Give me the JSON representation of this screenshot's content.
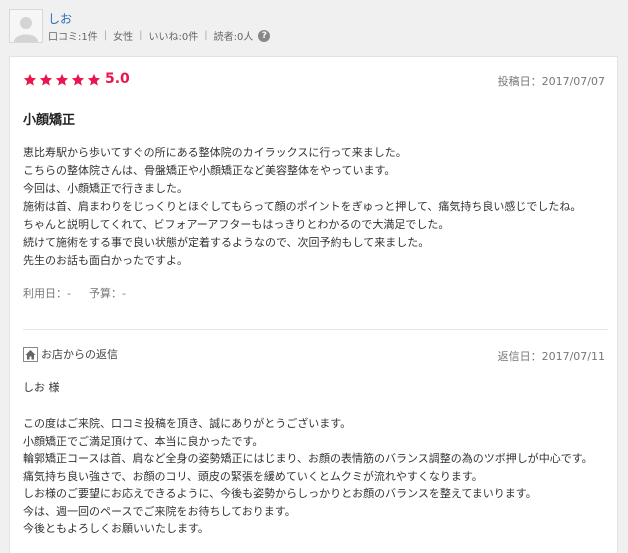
{
  "user": {
    "name": "しお",
    "stats": [
      "口コミ:1件",
      "女性",
      "いいね:0件",
      "読者:0人"
    ],
    "help": "?"
  },
  "review": {
    "rating": "5.0",
    "star_count": 5,
    "star_color": "#e8174e",
    "posted": "投稿日：2017/07/07",
    "title": "小顔矯正",
    "body": [
      "恵比寿駅から歩いてすぐの所にある整体院のカイラックスに行って来ました。",
      "こちらの整体院さんは、骨盤矯正や小顔矯正など美容整体をやっています。",
      "今回は、小顔矯正で行きました。",
      "施術は首、肩まわりをじっくりとほぐしてもらって顔のポイントをぎゅっと押して、痛気持ち良い感じでしたね。",
      "ちゃんと説明してくれて、ビフォアーアフターもはっきりとわかるので大満足でした。",
      "続けて施術をする事で良い状態が定着するようなので、次回予約もして来ました。",
      "先生のお話も面白かったですよ。"
    ],
    "usage": "利用日：-",
    "budget": "予算：-"
  },
  "reply": {
    "label": "お店からの返信",
    "date": "返信日：2017/07/11",
    "to": "しお 様",
    "body": [
      "この度はご来院、口コミ投稿を頂き、誠にありがとうございます。",
      "小顔矯正でご満足頂けて、本当に良かったです。",
      "輪郭矯正コースは首、肩など全身の姿勢矯正にはじまり、お顔の表情筋のバランス調整の為のツボ押しが中心です。",
      "痛気持ち良い強さで、お顔のコリ、頭皮の緊張を緩めていくとムクミが流れやすくなります。",
      "しお様のご要望にお応えできるように、今後も姿勢からしっかりとお顔のバランスを整えてまいります。",
      "今は、週一回のペースでご来院をお待ちしております。",
      "今後ともよろしくお願いいたします。"
    ]
  },
  "colors": {
    "accent": "#e8174e",
    "link": "#2a6ebb"
  },
  "icons": {
    "avatar": "default-avatar-icon",
    "help": "question-circle-icon",
    "star": "star-icon",
    "shop": "home-icon"
  }
}
